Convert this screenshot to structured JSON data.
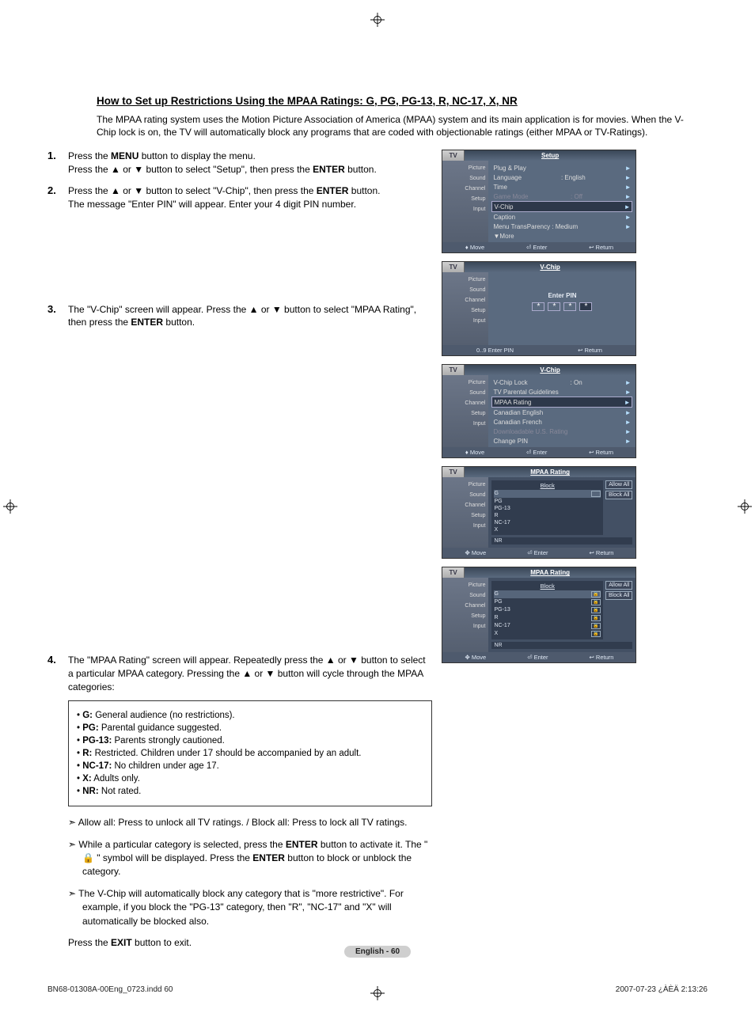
{
  "title": "How to Set up Restrictions Using the MPAA Ratings: G, PG, PG-13, R, NC-17, X, NR",
  "intro": "The MPAA rating system uses the Motion Picture Association of America (MPAA) system and its main application is for movies. When the V-Chip lock is on, the TV will automatically block any programs that are coded with objectionable ratings (either MPAA or TV-Ratings).",
  "steps": {
    "s1": {
      "num": "1.",
      "l1a": "Press the ",
      "l1b": "MENU",
      "l1c": " button to display the menu.",
      "l2a": "Press the ▲ or ▼ button to select \"Setup\", then press the ",
      "l2b": "ENTER",
      "l2c": " button."
    },
    "s2": {
      "num": "2.",
      "l1a": "Press the ▲ or ▼ button to select \"V-Chip\", then press the ",
      "l1b": "ENTER",
      "l1c": " button.",
      "l2": "The message \"Enter PIN\" will appear. Enter your 4 digit PIN number."
    },
    "s3": {
      "num": "3.",
      "l1": "The \"V-Chip\" screen will appear. Press the ▲ or ▼ button to select \"MPAA Rating\", then press the ",
      "l1b": "ENTER",
      "l1c": " button."
    },
    "s4": {
      "num": "4.",
      "l1": "The \"MPAA Rating\" screen will appear. Repeatedly press the ▲ or ▼ button to select a particular MPAA category. Pressing the ▲ or ▼ button will cycle through the MPAA categories:"
    }
  },
  "cats": {
    "g": {
      "l": "G:",
      "d": " General audience (no restrictions)."
    },
    "pg": {
      "l": "PG:",
      "d": " Parental guidance suggested."
    },
    "pg13": {
      "l": "PG-13:",
      "d": " Parents strongly cautioned."
    },
    "r": {
      "l": "R:",
      "d": " Restricted. Children under 17 should be accompanied by an adult."
    },
    "nc17": {
      "l": "NC-17:",
      "d": " No children under age 17."
    },
    "x": {
      "l": "X:",
      "d": " Adults only."
    },
    "nr": {
      "l": "NR:",
      "d": " Not rated."
    }
  },
  "notes": {
    "n1": "Allow all: Press to unlock all TV ratings. / Block all: Press to lock all TV ratings.",
    "n2a": "While a particular category is selected, press the ",
    "n2b": "ENTER",
    "n2c": " button to activate it. The \" 🔒 \" symbol will be displayed. Press the ",
    "n2d": "ENTER",
    "n2e": " button to block or unblock the category.",
    "n3": "The V-Chip will automatically block any category that is \"more restrictive\". For example, if you block the \"PG-13\" category, then \"R\", \"NC-17\" and \"X\" will automatically be blocked also."
  },
  "exit": {
    "a": "Press the ",
    "b": "EXIT",
    "c": " button to exit."
  },
  "tv": {
    "tvlbl": "TV",
    "side": {
      "picture": "Picture",
      "sound": "Sound",
      "channel": "Channel",
      "setup": "Setup",
      "input": "Input"
    },
    "foot": {
      "move": "Move",
      "enter": "Enter",
      "return": "Return",
      "enterpin": "Enter PIN"
    },
    "m1": {
      "title": "Setup",
      "r1": "Plug & Play",
      "r2": "Language",
      "r2v": ": English",
      "r3": "Time",
      "r4": "Game Mode",
      "r4v": ": Off",
      "r5": "V-Chip",
      "r6": "Caption",
      "r7": "Menu TransParency :  Medium",
      "r8": "▼More"
    },
    "m2": {
      "title": "V-Chip",
      "enter": "Enter PIN",
      "star": "*"
    },
    "m3": {
      "title": "V-Chip",
      "r1": "V-Chip Lock",
      "r1v": ": On",
      "r2": "TV Parental Guidelines",
      "r3": "MPAA Rating",
      "r4": "Canadian English",
      "r5": "Canadian French",
      "r6": "Downloadable U.S. Rating",
      "r7": "Change PIN"
    },
    "m4": {
      "title": "MPAA Rating",
      "block": "Block",
      "allow": "Allow All",
      "blockall": "Block All",
      "g": "G",
      "pg": "PG",
      "pg13": "PG-13",
      "r": "R",
      "nc17": "NC-17",
      "x": "X",
      "nr": "NR"
    }
  },
  "footer": "English - 60",
  "meta": {
    "left": "BN68-01308A-00Eng_0723.indd   60",
    "right": "2007-07-23   ¿ÀÈÄ 2:13:26"
  }
}
